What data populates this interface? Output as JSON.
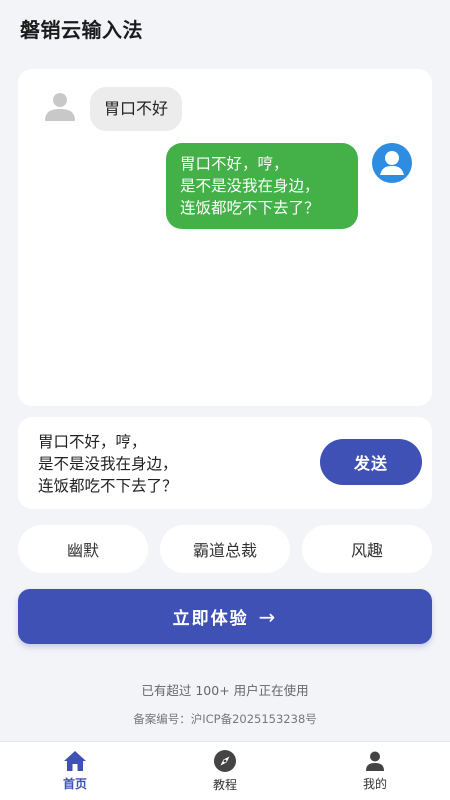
{
  "header": {
    "title": "磐销云输入法"
  },
  "chat": {
    "incoming": "胃口不好",
    "reply_lines": [
      "胃口不好，哼，",
      "是不是没我在身边，",
      "连饭都吃不下去了？"
    ]
  },
  "input": {
    "lines": [
      "胃口不好，哼，",
      "是不是没我在身边，",
      "连饭都吃不下去了？"
    ],
    "send_label": "发送"
  },
  "styles": [
    "幽默",
    "霸道总裁",
    "风趣"
  ],
  "cta": {
    "label": "立即体验",
    "arrow": "→"
  },
  "footer": {
    "users_note": "已有超过 100+ 用户正在使用",
    "icp": "备案编号：沪ICP备2025153238号"
  },
  "tabs": [
    {
      "label": "首页",
      "icon": "home-icon",
      "active": true
    },
    {
      "label": "教程",
      "icon": "compass-icon",
      "active": false
    },
    {
      "label": "我的",
      "icon": "person-icon",
      "active": false
    }
  ],
  "colors": {
    "primary": "#3f51b5",
    "bubble_green": "#43b048",
    "avatar_blue": "#2e8de0",
    "background": "#f3f4f8"
  }
}
